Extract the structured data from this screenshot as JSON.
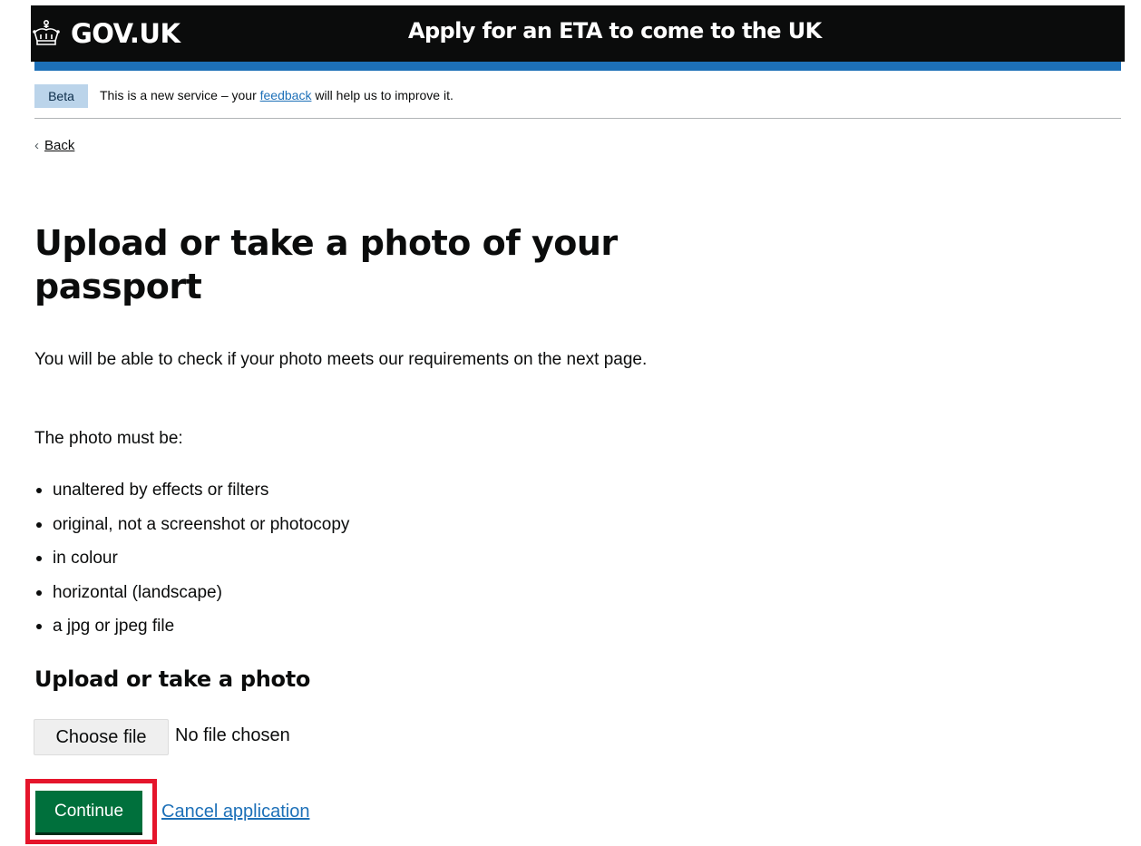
{
  "header": {
    "logo_text": "GOV.UK",
    "logo_icon": "crown-icon",
    "service_name": "Apply for an ETA to come to the UK"
  },
  "phase_banner": {
    "tag": "Beta",
    "text_before": "This is a new service – your ",
    "link_text": "feedback",
    "text_after": " will help us to improve it."
  },
  "back_link": {
    "chevron": "‹",
    "label": "Back"
  },
  "main": {
    "title": "Upload or take a photo of your passport",
    "intro": "You will be able to check if your photo meets our requirements on the next page.",
    "must_be": "The photo must be:",
    "requirements": [
      "unaltered by effects or filters",
      "original, not a screenshot or photocopy",
      "in colour",
      "horizontal (landscape)",
      "a jpg or jpeg file"
    ],
    "upload_heading": "Upload or take a photo",
    "file_button": "Choose file",
    "file_status": "No file chosen",
    "continue_button": "Continue",
    "cancel_link": "Cancel application"
  },
  "colors": {
    "header_bg": "#0b0c0c",
    "accent_blue": "#1d70b8",
    "beta_tag_bg": "#bbd4ea",
    "continue_green": "#00703c",
    "highlight_red": "#e5152b"
  }
}
